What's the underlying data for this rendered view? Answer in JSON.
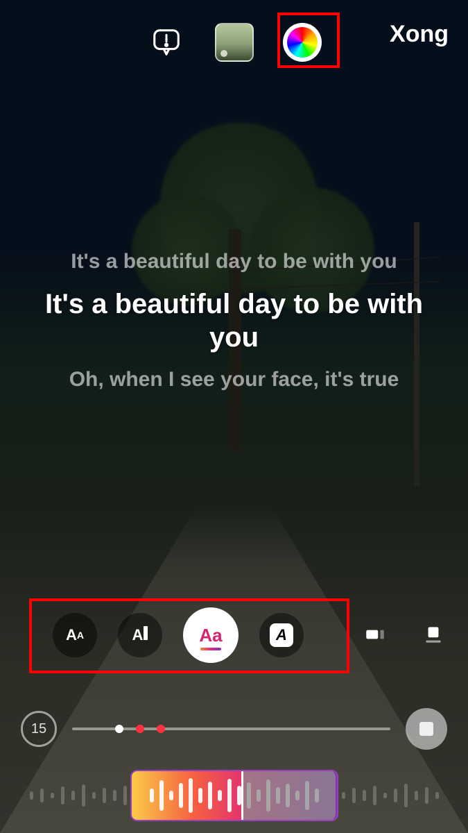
{
  "header": {
    "done_label": "Xong",
    "icons": {
      "report": "report-icon",
      "music_thumb": "music-thumbnail",
      "color_wheel": "color-wheel-icon"
    }
  },
  "lyrics": {
    "prev": "It's a beautiful day to be with you",
    "current": "It's a beautiful day to be with you",
    "next": "Oh, when I see your face, it's true"
  },
  "style_options": {
    "opt1_label": "AA",
    "opt2_label_a": "A",
    "opt3_label": "Aa",
    "opt4_label": "A",
    "selected_index": 2
  },
  "timeline": {
    "duration_label": "15"
  },
  "highlights": {
    "top": true,
    "styles": true
  }
}
